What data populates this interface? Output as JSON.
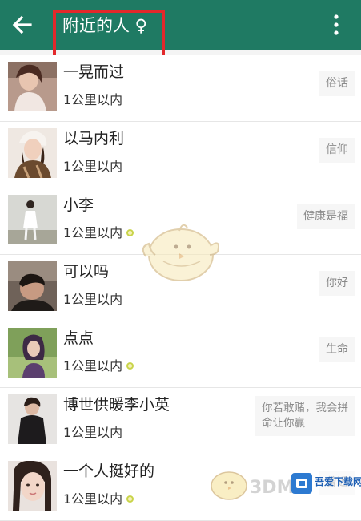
{
  "appbar": {
    "title": "附近的人 ♀",
    "back_icon": "arrow-left-icon",
    "more_icon": "more-vertical-icon",
    "background": "#1f7a63",
    "highlight_border": "#e3282b"
  },
  "people": [
    {
      "name": "一晃而过",
      "distance": "1公里以内",
      "online": false,
      "signature": "俗话"
    },
    {
      "name": "以马内利",
      "distance": "1公里以内",
      "online": false,
      "signature": "信仰"
    },
    {
      "name": "小李",
      "distance": "1公里以内",
      "online": true,
      "signature": "健康是福"
    },
    {
      "name": "可以吗",
      "distance": "1公里以内",
      "online": false,
      "signature": "你好"
    },
    {
      "name": "点点",
      "distance": "1公里以内",
      "online": true,
      "signature": "生命"
    },
    {
      "name": "博世供暖李小英",
      "distance": "1公里以内",
      "online": false,
      "signature": "你若敢赌，我会拼命让你赢"
    },
    {
      "name": "一个人挺好的",
      "distance": "1公里以内",
      "online": true,
      "signature": "曾近"
    }
  ],
  "watermark": {
    "text_3dm": "3DM",
    "brand": "吾爱下载网"
  }
}
